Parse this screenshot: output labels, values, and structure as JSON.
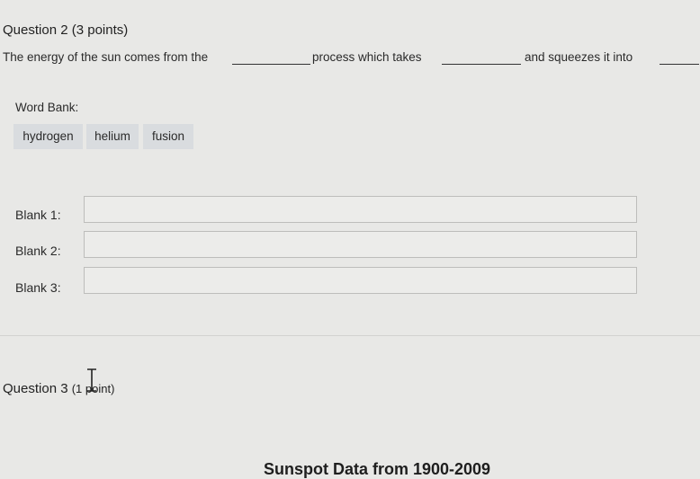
{
  "question2": {
    "number_label": "Question 2",
    "points": "(3 points)",
    "sentence": {
      "part1": "The energy of the sun comes from the",
      "part2": "process which takes",
      "part3": "and squeezes it into"
    },
    "word_bank_label": "Word Bank:",
    "word_bank": [
      "hydrogen",
      "helium",
      "fusion"
    ],
    "blanks": [
      {
        "label": "Blank 1:",
        "value": ""
      },
      {
        "label": "Blank 2:",
        "value": ""
      },
      {
        "label": "Blank 3:",
        "value": ""
      }
    ]
  },
  "question3": {
    "number_label": "Question 3",
    "points": "(1 point)",
    "cursor_icon": "text-cursor-icon",
    "section_heading": "Sunspot Data from 1900-2009"
  }
}
